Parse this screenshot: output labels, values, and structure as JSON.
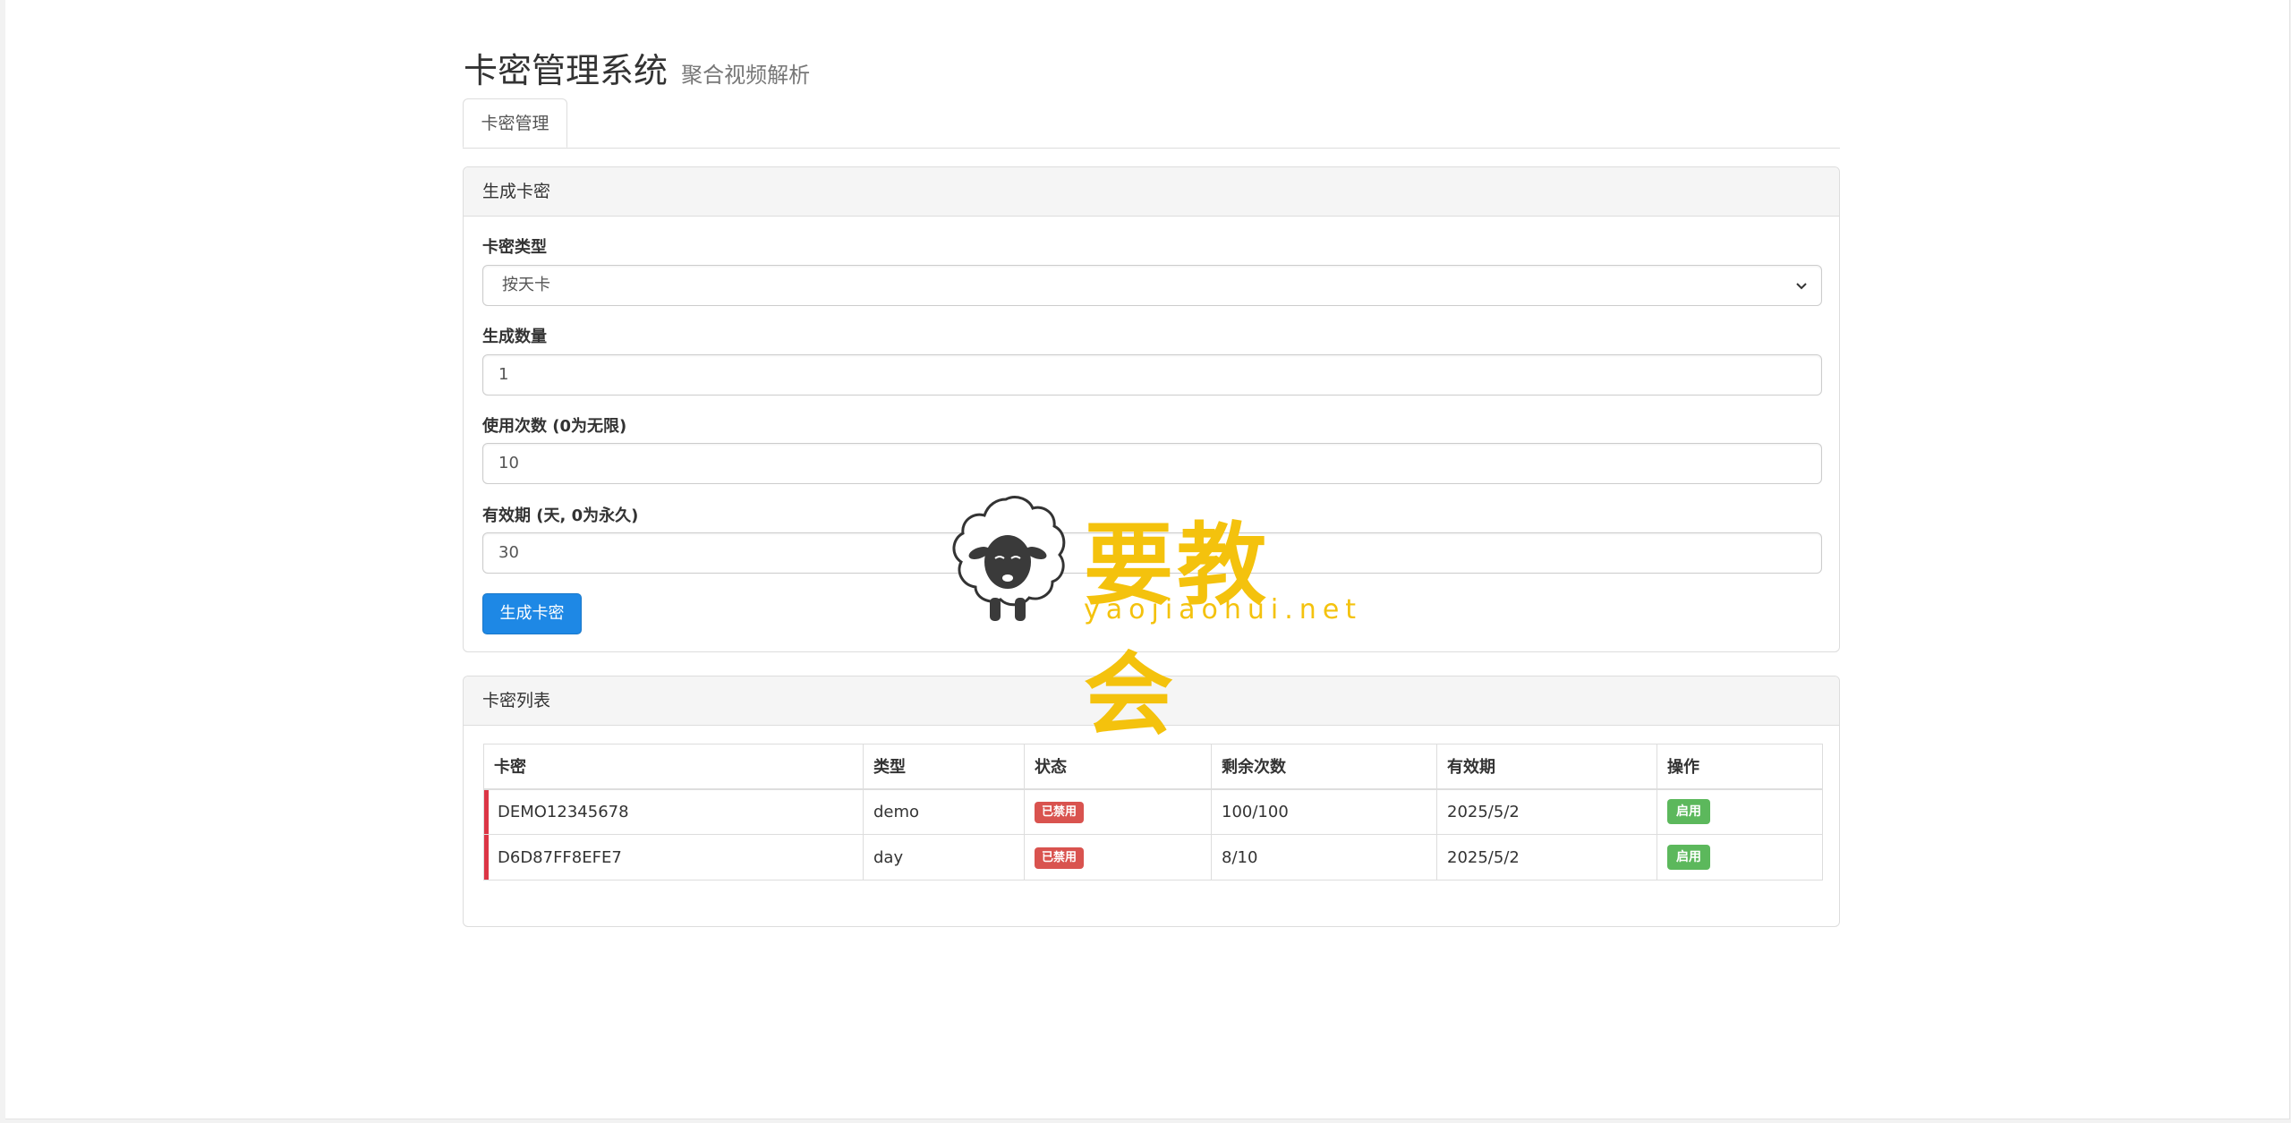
{
  "header": {
    "title": "卡密管理系统",
    "subtitle": "聚合视频解析"
  },
  "tabs": [
    {
      "label": "卡密管理",
      "active": true
    }
  ],
  "generate_panel": {
    "heading": "生成卡密",
    "type_label": "卡密类型",
    "type_value": "按天卡",
    "count_label": "生成数量",
    "count_value": "1",
    "uses_label": "使用次数 (0为无限)",
    "uses_value": "10",
    "validity_label": "有效期 (天, 0为永久)",
    "validity_value": "30",
    "submit_label": "生成卡密"
  },
  "list_panel": {
    "heading": "卡密列表",
    "columns": [
      "卡密",
      "类型",
      "状态",
      "剩余次数",
      "有效期",
      "操作"
    ],
    "rows": [
      {
        "code": "DEMO12345678",
        "type": "demo",
        "status": "已禁用",
        "remaining": "100/100",
        "expires": "2025/5/2",
        "action": "启用"
      },
      {
        "code": "D6D87FF8EFE7",
        "type": "day",
        "status": "已禁用",
        "remaining": "8/10",
        "expires": "2025/5/2",
        "action": "启用"
      }
    ]
  },
  "watermark": {
    "text": "要教会",
    "url": "yaojiaohui.net"
  },
  "colors": {
    "primary_button": "#1e88e5",
    "disabled_badge": "#d9534f",
    "enable_button": "#5cb85c",
    "row_marker": "#dc3545",
    "watermark": "#f4c20d"
  }
}
